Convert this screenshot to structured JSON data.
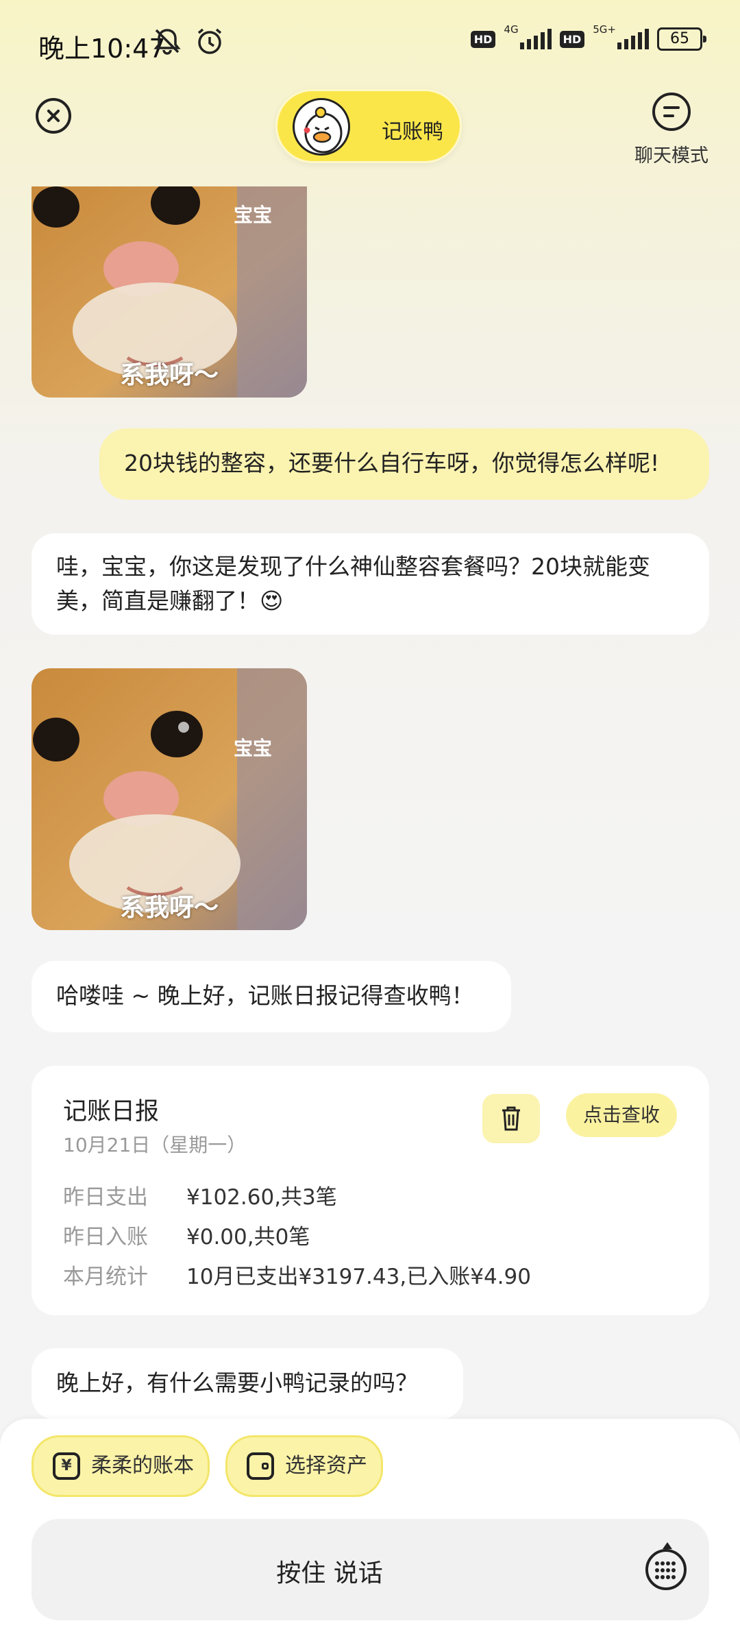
{
  "status_bar": {
    "time": "晚上10:47",
    "network_labels": [
      "4G",
      "5G+"
    ],
    "hd_label": "HD",
    "battery": "65",
    "icons": [
      "mute-icon",
      "alarm-icon"
    ]
  },
  "header": {
    "bot_name": "记账鸭",
    "chat_mode_label": "聊天模式"
  },
  "messages": {
    "sticker_top_caption": "系我呀～",
    "sticker_side_caption": "宝宝",
    "user_msg": "20块钱的整容，还要什么自行车呀，你觉得怎么样呢!",
    "bot_reply": "哇，宝宝，你这是发现了什么神仙整容套餐吗？20块就能变美，简直是赚翻了！😍",
    "greeting": "哈喽哇 ~ 晚上好，记账日报记得查收鸭！",
    "final_msg": "晚上好，有什么需要小鸭记录的吗？"
  },
  "report": {
    "title": "记账日报",
    "date": "10月21日（星期一）",
    "check_label": "点击查收",
    "rows": [
      {
        "key": "昨日支出",
        "value": "¥102.60,共3笔"
      },
      {
        "key": "昨日入账",
        "value": "¥0.00,共0笔"
      },
      {
        "key": "本月统计",
        "value": "10月已支出¥3197.43,已入账¥4.90"
      }
    ]
  },
  "bottom": {
    "chip_ledger": "柔柔的账本",
    "chip_ledger_icon": "¥",
    "chip_assets": "选择资产",
    "voice_label": "按住 说话"
  },
  "colors": {
    "accent_yellow": "#fbe64a",
    "bubble_yellow": "#fbf3b0",
    "background": "#f4f4f4"
  }
}
